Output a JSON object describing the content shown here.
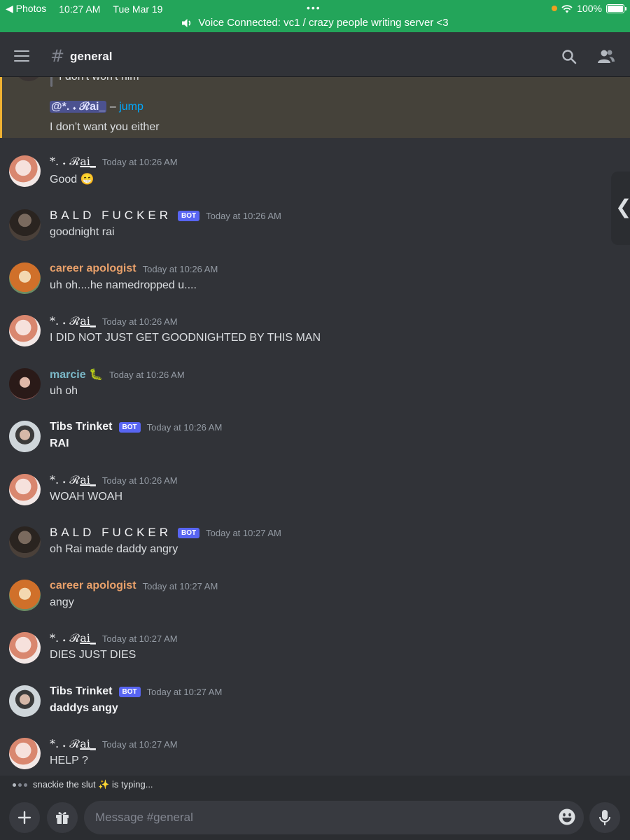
{
  "status_bar": {
    "back_label": "◀ Photos",
    "time": "10:27 AM",
    "date": "Tue Mar 19",
    "multitask_dots": "•••",
    "battery": "100%",
    "battery_level": 1.0,
    "voice_banner": "Voice Connected: vc1 / crazy people writing server <3"
  },
  "header": {
    "channel_hash": "#",
    "channel_name": "general"
  },
  "reply_highlight": {
    "cut_text": "I don't won't him",
    "mention": "@*. 𝆺 ℛai_",
    "jump_separator": "–",
    "jump_label": "jump",
    "text": "I don’t want you either"
  },
  "messages": [
    {
      "user": "*. 𝆺 ℛ",
      "user_suffix": "ai_",
      "time": "Today at 10:26 AM",
      "text": "Good 😁"
    },
    {
      "user": "BALD FUCKER",
      "bot": "BOT",
      "time": "Today at 10:26 AM",
      "text": "goodnight rai"
    },
    {
      "user": "career apologist",
      "time": "Today at 10:26 AM",
      "text": "uh oh....he namedropped u...."
    },
    {
      "user": "*. 𝆺 ℛ",
      "user_suffix": "ai_",
      "time": "Today at 10:26 AM",
      "text": "I DID NOT JUST GET GOODNIGHTED BY THIS MAN"
    },
    {
      "user": "marcie 🐛",
      "time": "Today at 10:26 AM",
      "text": "uh oh"
    },
    {
      "user": "Tibs Trinket",
      "bot": "BOT",
      "time": "Today at 10:26 AM",
      "text": "RAI"
    },
    {
      "user": "*. 𝆺 ℛ",
      "user_suffix": "ai_",
      "time": "Today at 10:26 AM",
      "text": "WOAH WOAH"
    },
    {
      "user": "BALD FUCKER",
      "bot": "BOT",
      "time": "Today at 10:27 AM",
      "text": "oh Rai made daddy angry"
    },
    {
      "user": "career apologist",
      "time": "Today at 10:27 AM",
      "text": "angy"
    },
    {
      "user": "*. 𝆺 ℛ",
      "user_suffix": "ai_",
      "time": "Today at 10:27 AM",
      "text": "DIES JUST DIES"
    },
    {
      "user": "Tibs Trinket",
      "bot": "BOT",
      "time": "Today at 10:27 AM",
      "text": "daddys angy"
    },
    {
      "user": "*. 𝆺 ℛ",
      "user_suffix": "ai_",
      "time": "Today at 10:27 AM",
      "text": "HELP ?"
    }
  ],
  "side_tab": {
    "glyph": "❮"
  },
  "typing": {
    "text": "snackie the slut ✨ is typing..."
  },
  "composer": {
    "placeholder": "Message #general",
    "value": ""
  },
  "colors": {
    "status_green": "#23a55a",
    "background": "#313338",
    "mention_highlight": "#45423a",
    "mention_bar": "#f0b232",
    "bot_tag": "#5865f2",
    "link": "#00a8fc"
  },
  "icons": [
    "back-arrow-icon",
    "wifi-icon",
    "battery-icon",
    "speaker-icon",
    "hamburger-icon",
    "hash-icon",
    "search-icon",
    "members-icon",
    "chevron-left-icon",
    "plus-icon",
    "gift-icon",
    "emoji-icon",
    "microphone-icon"
  ]
}
